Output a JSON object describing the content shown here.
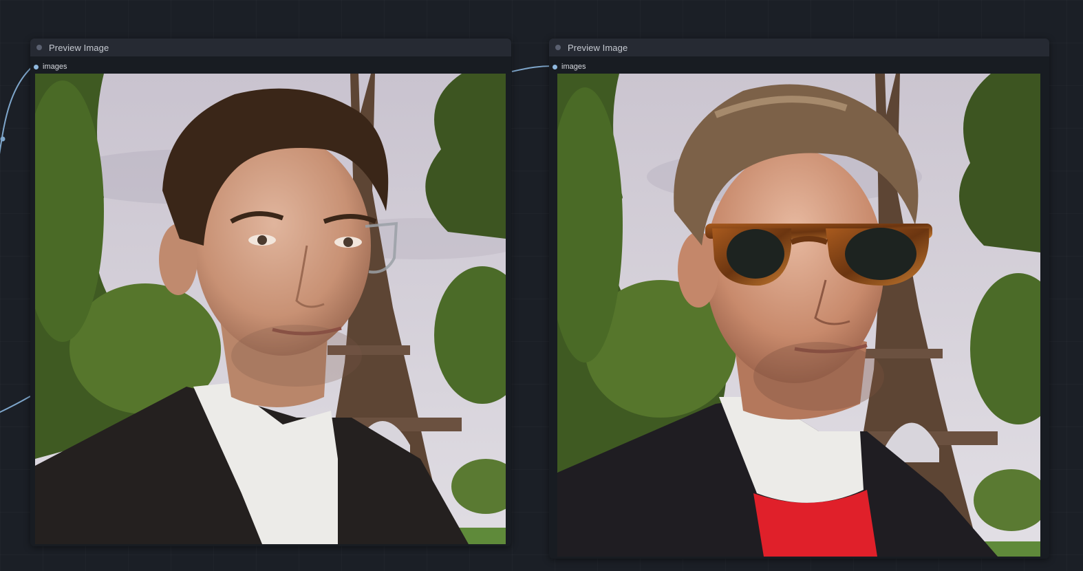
{
  "canvas": {
    "background": "#1b1f26",
    "wire_color": "#7fa7cc"
  },
  "nodes": [
    {
      "title": "Preview Image",
      "input_label": "images",
      "image": {
        "description": "portrait-eiffel-tower-clear-glasses",
        "eyewear": "clear-frame-glasses",
        "inner_layer": "white-shirt"
      }
    },
    {
      "title": "Preview Image",
      "input_label": "images",
      "image": {
        "description": "portrait-eiffel-tower-tortoiseshell-sunglasses",
        "eyewear": "tortoiseshell-sunglasses",
        "inner_layer": "red-sweater"
      }
    }
  ]
}
